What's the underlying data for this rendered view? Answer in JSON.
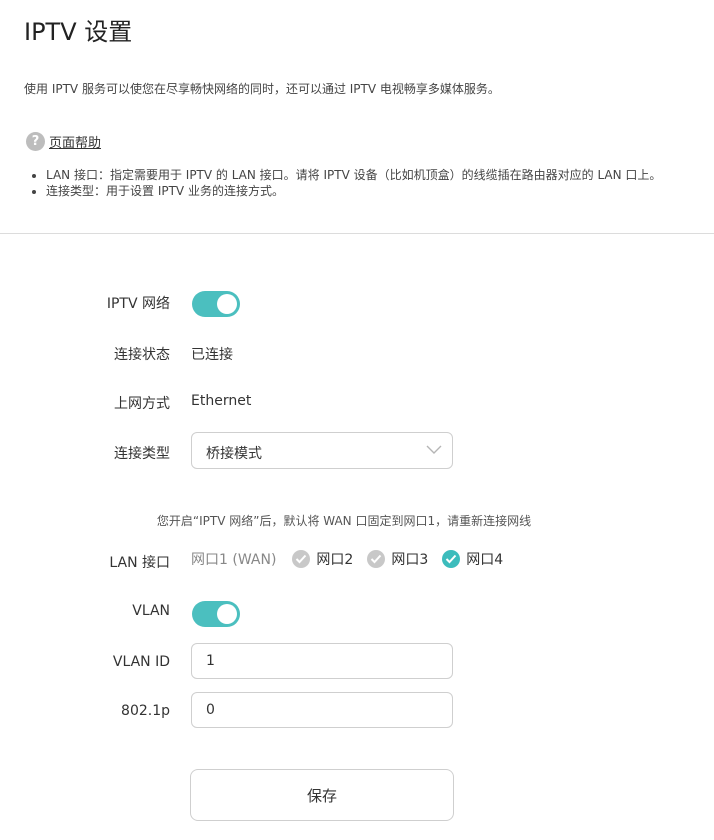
{
  "header": {
    "title": "IPTV 设置",
    "description": "使用 IPTV 服务可以使您在尽享畅快网络的同时，还可以通过 IPTV 电视畅享多媒体服务。",
    "help_icon_glyph": "?",
    "help_label": "页面帮助",
    "help_items": [
      "LAN 接口：指定需要用于 IPTV 的 LAN 接口。请将 IPTV 设备（比如机顶盒）的线缆插在路由器对应的 LAN 口上。",
      "连接类型：用于设置 IPTV 业务的连接方式。"
    ]
  },
  "form": {
    "iptv_network": {
      "label": "IPTV 网络",
      "enabled": true
    },
    "connection_status": {
      "label": "连接状态",
      "value": "已连接"
    },
    "internet_mode": {
      "label": "上网方式",
      "value": "Ethernet"
    },
    "connection_type": {
      "label": "连接类型",
      "selected": "桥接模式"
    },
    "note": "您开启“IPTV 网络”后，默认将 WAN 口固定到网口1，请重新连接网线",
    "lan_port": {
      "label": "LAN 接口",
      "fixed": "网口1 (WAN)",
      "options": [
        {
          "label": "网口2",
          "checked": false
        },
        {
          "label": "网口3",
          "checked": false
        },
        {
          "label": "网口4",
          "checked": true
        }
      ]
    },
    "vlan": {
      "label": "VLAN",
      "enabled": true
    },
    "vlan_id": {
      "label": "VLAN ID",
      "value": "1"
    },
    "p8021": {
      "label": "802.1p",
      "value": "0"
    },
    "save_label": "保存"
  },
  "colors": {
    "accent": "#4bbfbf",
    "check_on": "#3cbcbc",
    "check_off": "#c8c8c8"
  }
}
